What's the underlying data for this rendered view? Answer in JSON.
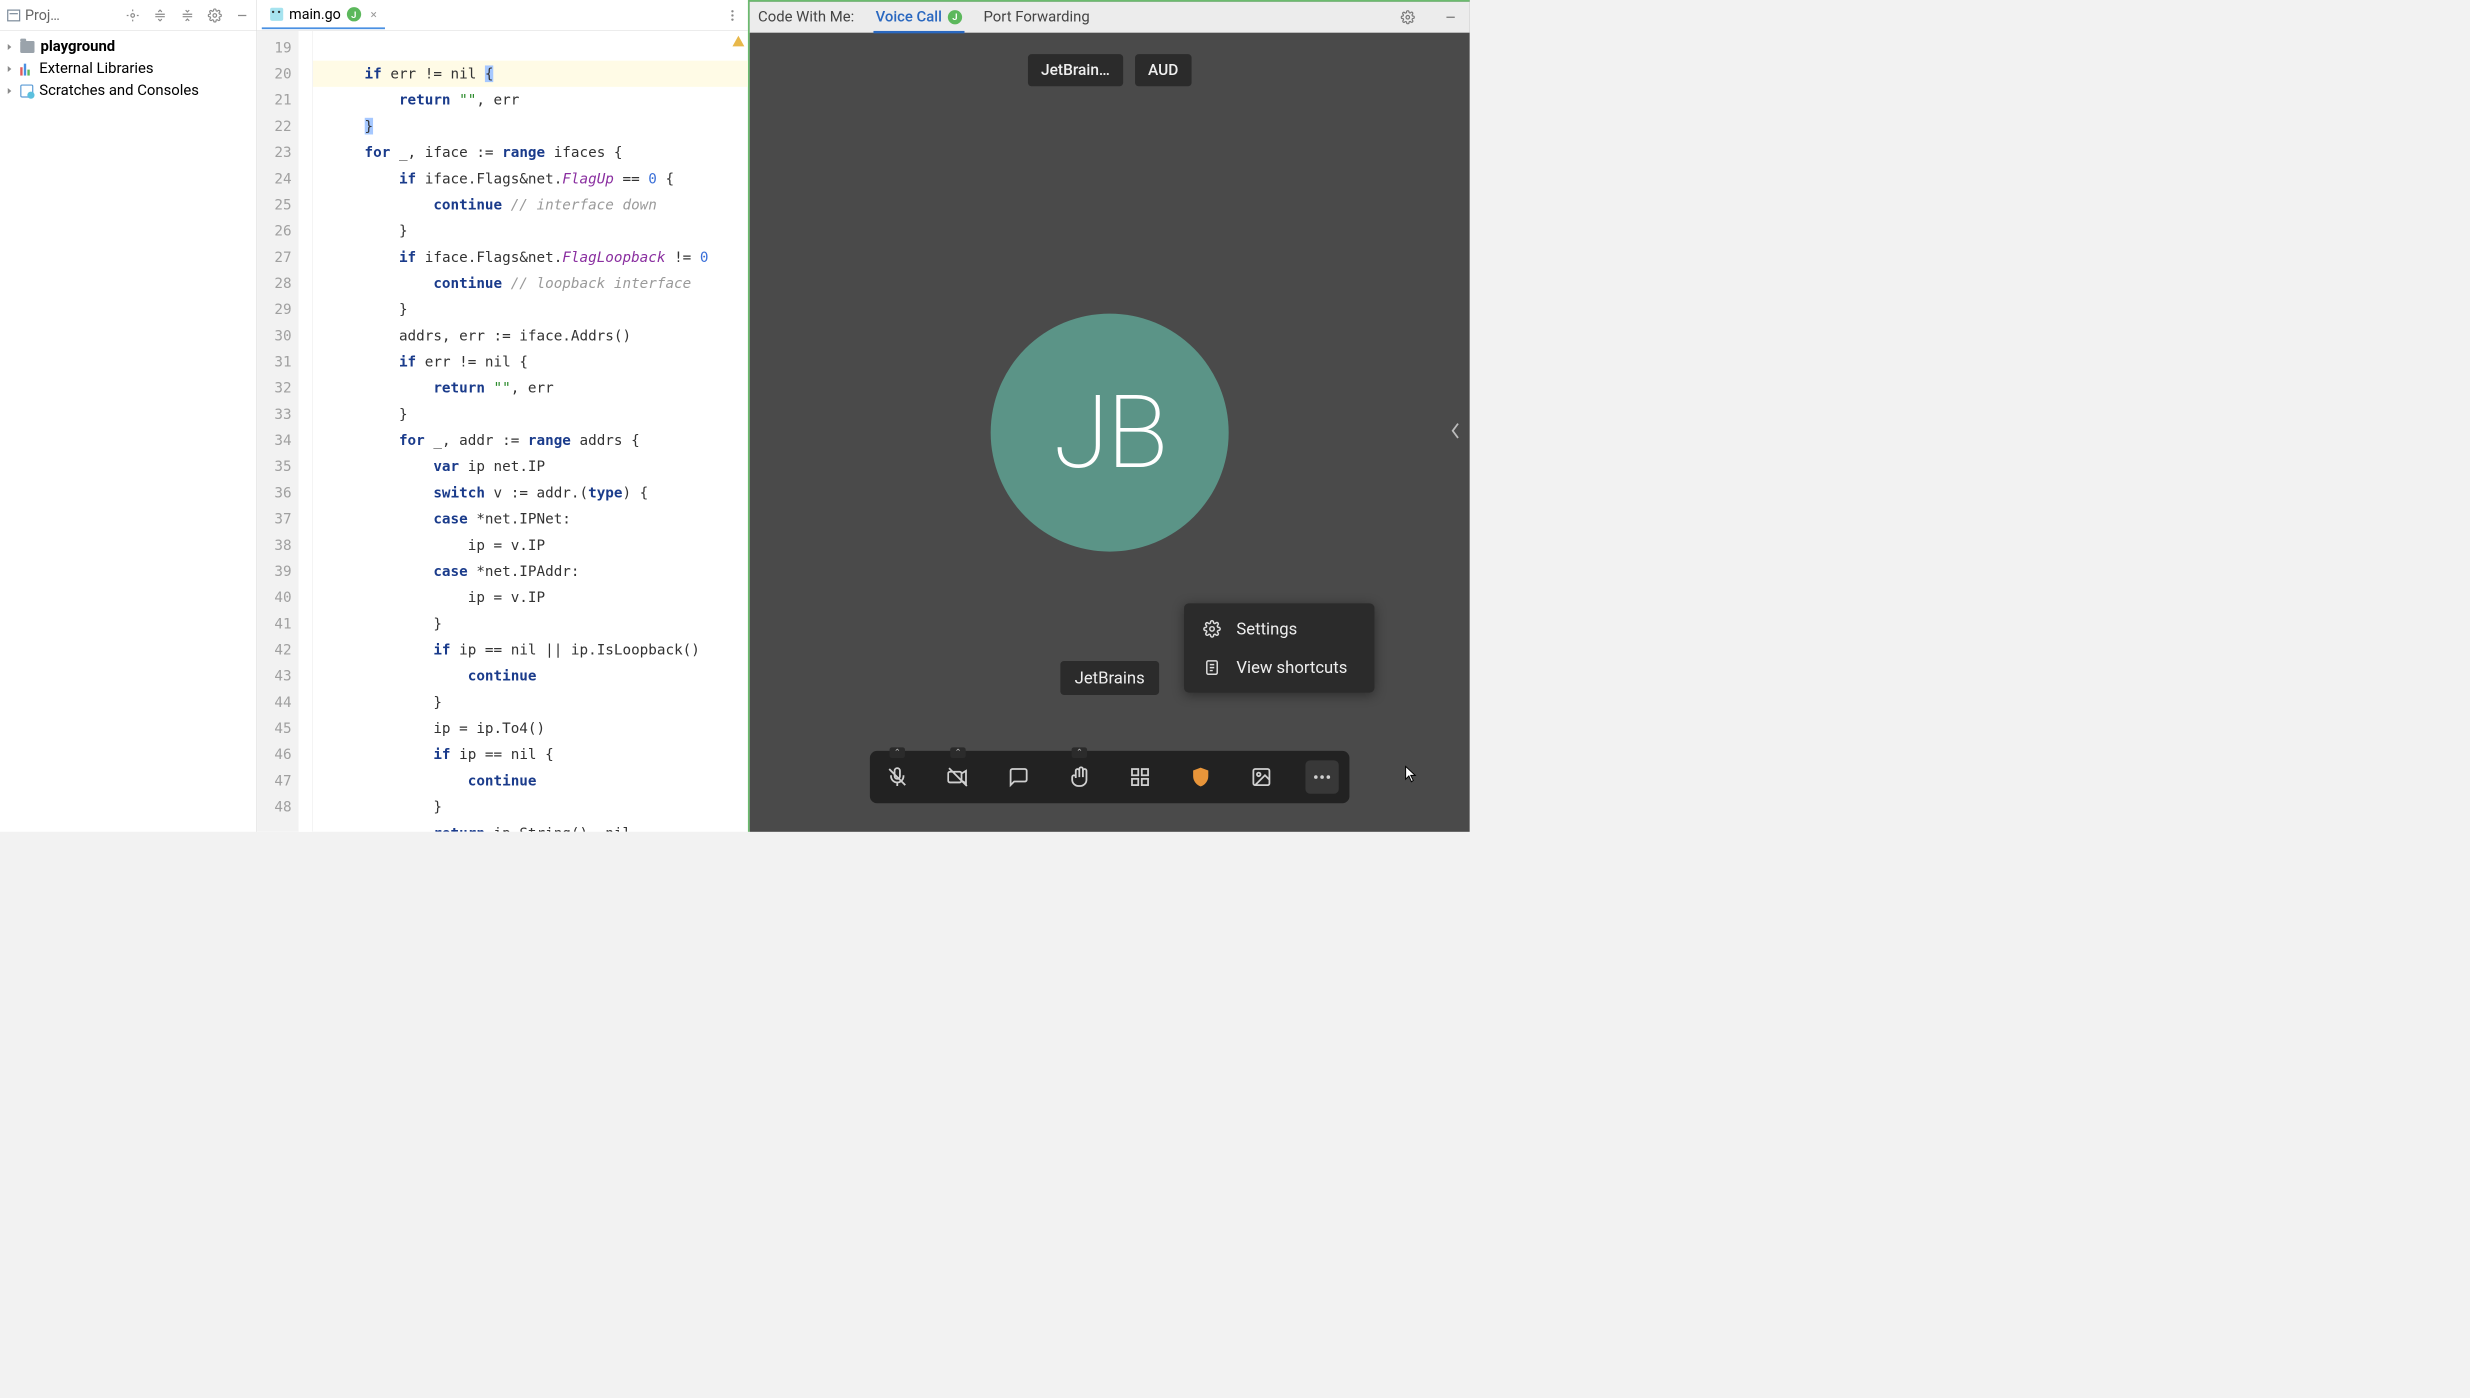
{
  "left": {
    "project_label": "Proj…",
    "tree": {
      "playground": "playground",
      "external_libs": "External Libraries",
      "scratches": "Scratches and Consoles"
    }
  },
  "editor": {
    "tab": {
      "file": "main.go",
      "badge": "J"
    },
    "line_start": 19,
    "line_end": 48,
    "code": {
      "l19_if": "if",
      "l19_cond": " err != nil ",
      "l19_brace": "{",
      "l20_return": "return",
      "l20_rest": " ",
      "l20_str": "\"\"",
      "l20_after": ", err",
      "l21": "}",
      "l22_for": "for",
      "l22_rest": " _, iface := ",
      "l22_range": "range",
      "l22_after": " ifaces {",
      "l23_if": "if",
      "l23_rest": " iface.Flags&net.",
      "l23_field": "FlagUp",
      "l23_after": " == ",
      "l23_num": "0",
      "l23_brace": " {",
      "l24_continue": "continue",
      "l24_cmt": " // interface down",
      "l25": "}",
      "l26_if": "if",
      "l26_rest": " iface.Flags&net.",
      "l26_field": "FlagLoopback",
      "l26_after": " != ",
      "l26_num": "0",
      "l27_continue": "continue",
      "l27_cmt": " // loopback interface",
      "l28": "}",
      "l29": "addrs, err := iface.Addrs()",
      "l30_if": "if",
      "l30_rest": " err != nil {",
      "l31_return": "return",
      "l31_str": "\"\"",
      "l31_after": ", err",
      "l32": "}",
      "l33_for": "for",
      "l33_rest": " _, addr := ",
      "l33_range": "range",
      "l33_after": " addrs {",
      "l34_var": "var",
      "l34_rest": " ip net.IP",
      "l35_switch": "switch",
      "l35_rest": " v := addr.(",
      "l35_type": "type",
      "l35_after": ") {",
      "l36_case": "case",
      "l36_rest": " *net.IPNet:",
      "l37": "ip = v.IP",
      "l38_case": "case",
      "l38_rest": " *net.IPAddr:",
      "l39": "ip = v.IP",
      "l40": "}",
      "l41_if": "if",
      "l41_rest": " ip == nil || ip.IsLoopback()",
      "l42_continue": "continue",
      "l43": "}",
      "l44": "ip = ip.To4()",
      "l45_if": "if",
      "l45_rest": " ip == nil {",
      "l46_continue": "continue",
      "l47": "}",
      "l48_return": "return",
      "l48_rest": " ip.String(), nil"
    }
  },
  "right": {
    "header": {
      "code_with_me": "Code With Me:",
      "voice_call": "Voice Call",
      "voice_badge": "J",
      "port_forwarding": "Port Forwarding"
    },
    "chips": {
      "jetbrain": "JetBrain…",
      "aud": "AUD"
    },
    "avatar_initials": "JB",
    "name": "JetBrains",
    "popup": {
      "settings": "Settings",
      "shortcuts": "View shortcuts"
    }
  }
}
